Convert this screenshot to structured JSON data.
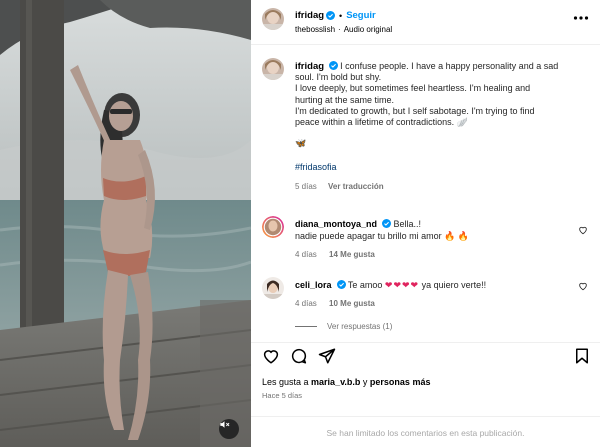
{
  "post": {
    "username": "ifridag",
    "follow_label": "Seguir",
    "separator": "•",
    "audio_owner": "thebosslish",
    "audio_separator": "·",
    "audio_label": "Audio original"
  },
  "caption": {
    "username": "ifridag",
    "lines": [
      "I confuse people. I have a happy personality and a sad",
      "soul. I'm bold but shy.",
      "I love deeply, but sometimes feel heartless. I'm healing and",
      "hurting at the same time.",
      "I'm dedicated to growth, but I self sabotage. I'm trying to find",
      "peace within a lifetime of contradictions. 🪽"
    ],
    "emoji": "🦋",
    "hashtag": "#fridasofia",
    "time": "5 días",
    "translation_label": "Ver traducción"
  },
  "comments": [
    {
      "username": "diana_montoya_nd",
      "text_line1": "Bella..!",
      "text_line2": "nadie puede apagar tu brillo mi amor 🔥 🔥",
      "time": "4 días",
      "likes": "14 Me gusta",
      "reply": "Responder"
    },
    {
      "username": "celi_lora",
      "text_prefix": "Te amoo",
      "hearts": "❤❤❤❤",
      "text_suffix": "ya quiero verte!!",
      "time": "4 días",
      "likes": "10 Me gusta",
      "reply": "Responder"
    }
  ],
  "replies_label": "Ver respuestas (1)",
  "likes_summary": {
    "prefix": "Les gusta a ",
    "user": "maria_v.b.b",
    "middle": " y ",
    "others": "personas más"
  },
  "time_ago": "Hace 5 días",
  "comments_limited": "Se han limitado los comentarios en esta publicación.",
  "icons": {
    "verified": "verified-badge-icon",
    "more": "more-options-icon",
    "like": "heart-icon",
    "comment": "comment-icon",
    "share": "paper-plane-icon",
    "save": "bookmark-icon",
    "mute": "muted-speaker-icon"
  },
  "colors": {
    "link_blue": "#0095f6",
    "hashtag": "#00376b",
    "verified": "#0095f6",
    "muted_text": "#737373"
  }
}
